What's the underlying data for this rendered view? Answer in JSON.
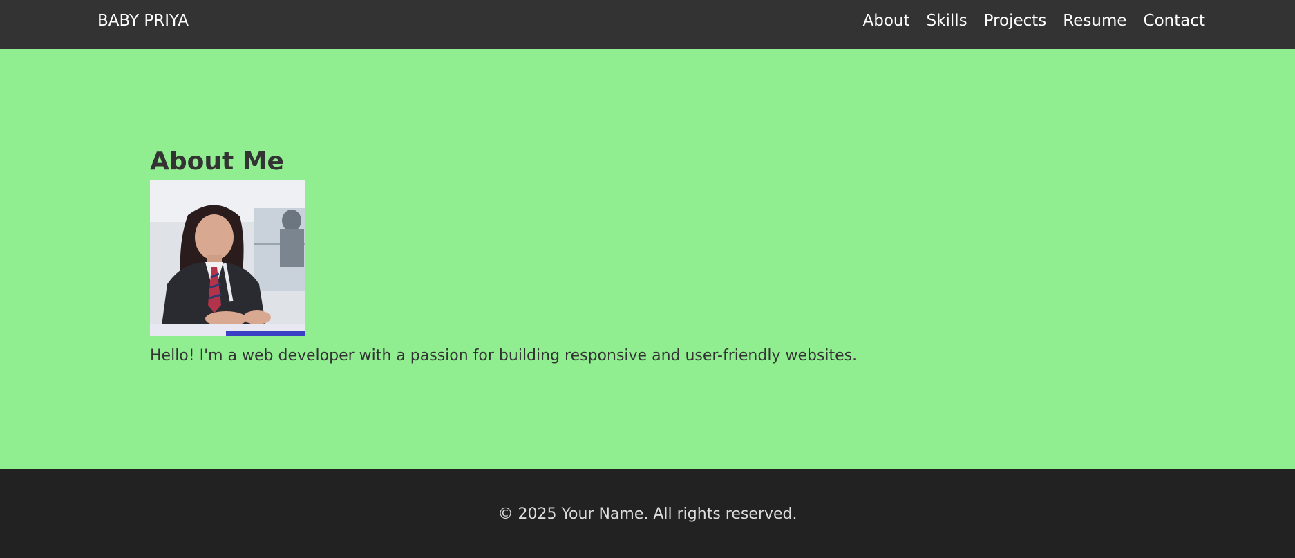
{
  "navbar": {
    "brand": "BABY PRIYA",
    "links": [
      "About",
      "Skills",
      "Projects",
      "Resume",
      "Contact"
    ]
  },
  "about": {
    "heading": "About Me",
    "photo_alt": "Profile photo",
    "text": "Hello! I'm a web developer with a passion for building responsive and user-friendly websites."
  },
  "footer": {
    "text": "© 2025 Your Name. All rights reserved."
  },
  "colors": {
    "navbar_bg": "#333333",
    "hero_bg": "#90ee90",
    "footer_bg": "#222222",
    "text_dark": "#333333"
  }
}
